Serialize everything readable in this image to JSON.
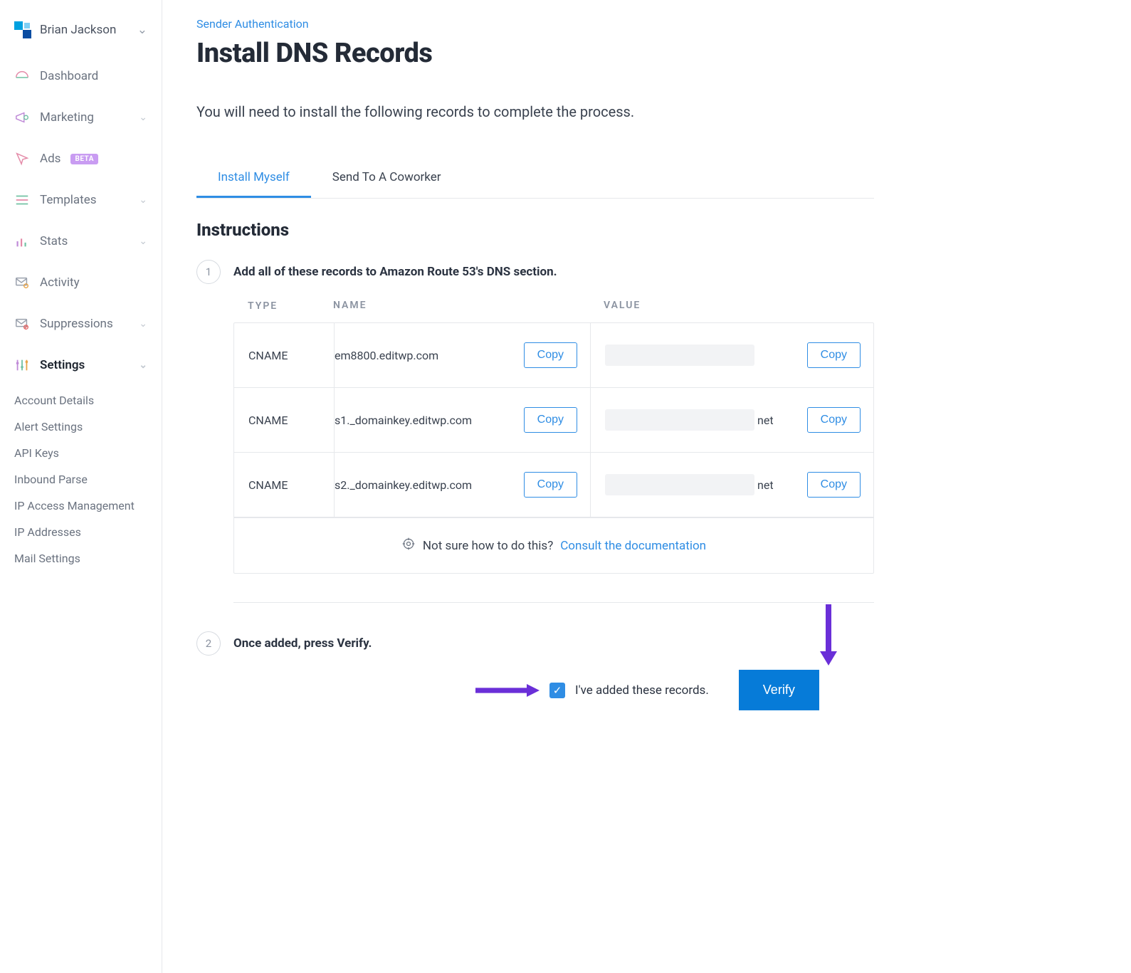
{
  "account": {
    "name": "Brian Jackson"
  },
  "sidebar": {
    "items": [
      {
        "label": "Dashboard"
      },
      {
        "label": "Marketing"
      },
      {
        "label": "Ads",
        "badge": "BETA"
      },
      {
        "label": "Templates"
      },
      {
        "label": "Stats"
      },
      {
        "label": "Activity"
      },
      {
        "label": "Suppressions"
      },
      {
        "label": "Settings"
      }
    ],
    "subitems": [
      "Account Details",
      "Alert Settings",
      "API Keys",
      "Inbound Parse",
      "IP Access Management",
      "IP Addresses",
      "Mail Settings"
    ]
  },
  "breadcrumb": "Sender Authentication",
  "page_title": "Install DNS Records",
  "lead": "You will need to install the following records to complete the process.",
  "tabs": [
    {
      "label": "Install Myself",
      "active": true
    },
    {
      "label": "Send To A Coworker",
      "active": false
    }
  ],
  "section_title": "Instructions",
  "step1": {
    "num": "1",
    "text": "Add all of these records to Amazon Route 53's DNS section."
  },
  "table": {
    "headers": {
      "type": "TYPE",
      "name": "NAME",
      "value": "VALUE"
    },
    "copy_label": "Copy",
    "rows": [
      {
        "type": "CNAME",
        "name": "em8800.editwp.com",
        "value_suffix": ""
      },
      {
        "type": "CNAME",
        "name": "s1._domainkey.editwp.com",
        "value_suffix": "net"
      },
      {
        "type": "CNAME",
        "name": "s2._domainkey.editwp.com",
        "value_suffix": "net"
      }
    ]
  },
  "doc_hint": {
    "text": "Not sure how to do this?",
    "link": "Consult the documentation"
  },
  "step2": {
    "num": "2",
    "text": "Once added, press Verify."
  },
  "verify": {
    "checkbox_label": "I've added these records.",
    "button": "Verify",
    "checked": true
  }
}
